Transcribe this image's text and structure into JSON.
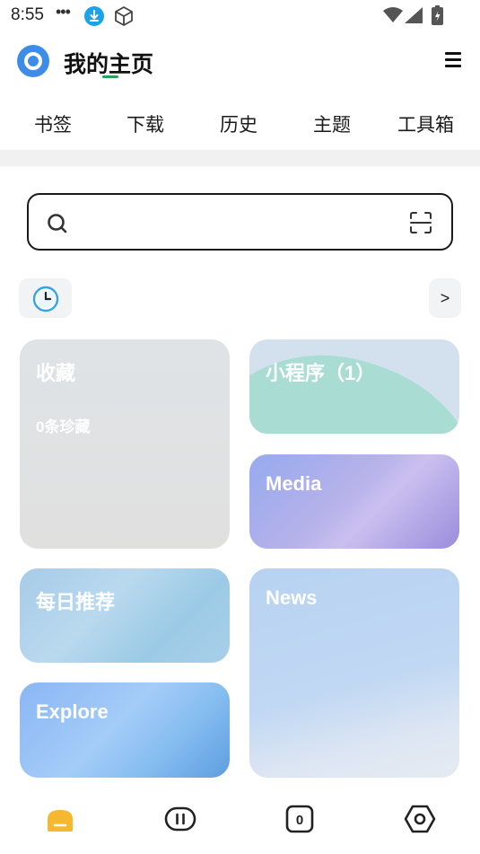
{
  "status_bar": {
    "time": "8:55",
    "dots": "•••",
    "icons": [
      "download-notification-icon",
      "cube-icon",
      "wifi-icon",
      "cellular-signal-icon",
      "battery-icon"
    ]
  },
  "header": {
    "title": "我的主页",
    "logo_icon": "browser-logo-icon",
    "menu_icon": "menu-icon",
    "accent_color": "#27a35a",
    "logo_color": "#3d8ce8"
  },
  "tabs": [
    {
      "label": "书签"
    },
    {
      "label": "下载"
    },
    {
      "label": "历史"
    },
    {
      "label": "主题"
    },
    {
      "label": "工具箱"
    }
  ],
  "search": {
    "value": "",
    "placeholder": "",
    "left_icon": "search-icon",
    "right_icon": "scan-icon"
  },
  "quick_row": {
    "clock_icon": "clock-icon",
    "more_label": ">"
  },
  "cards": {
    "favorites": {
      "title": "收藏",
      "subtitle": "0条珍藏"
    },
    "mini_programs": {
      "title": "小程序（1）"
    },
    "media": {
      "title": "Media"
    },
    "daily": {
      "title": "每日推荐"
    },
    "news": {
      "title": "News"
    },
    "explore": {
      "title": "Explore"
    }
  },
  "bottom_nav": {
    "items": [
      {
        "icon": "home-icon",
        "active": true,
        "color": "#f5b82e"
      },
      {
        "icon": "pause-icon"
      },
      {
        "icon": "tabs-icon",
        "count": "0"
      },
      {
        "icon": "settings-icon"
      }
    ]
  }
}
